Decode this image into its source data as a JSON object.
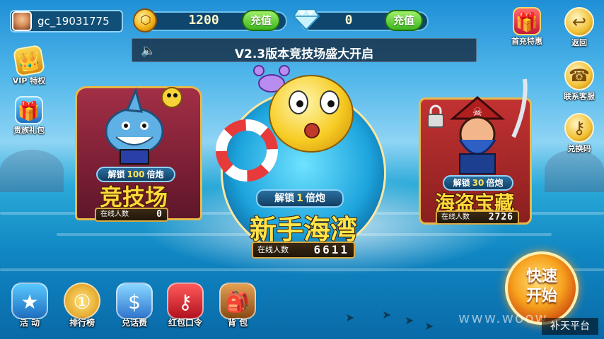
{
  "user": {
    "name": "gc_19031775"
  },
  "resources": {
    "gold": {
      "value": "1200",
      "charge_label": "充值"
    },
    "diamond": {
      "value": "0",
      "charge_label": "充值"
    }
  },
  "notice": {
    "text": "V2.3版本竞技场盛大开启"
  },
  "left_menu": {
    "vip": "VIP 特权",
    "noble_gift": "贵族礼包"
  },
  "right_menu": {
    "first_charge": "首充特惠",
    "back": "返回",
    "contact": "联系客服",
    "redeem": "兑换码"
  },
  "rooms": {
    "arena": {
      "unlock_prefix": "解锁",
      "unlock_value": "100",
      "unlock_suffix": "倍炮",
      "title": "竞技场",
      "online_label": "在线人数",
      "online_count": "0"
    },
    "newbie": {
      "unlock_prefix": "解锁",
      "unlock_value": "1",
      "unlock_suffix": "倍炮",
      "title": "新手海湾",
      "online_label": "在线人数",
      "online_count": "6611"
    },
    "pirate": {
      "unlock_prefix": "解锁",
      "unlock_value": "30",
      "unlock_suffix": "倍炮",
      "title": "海盗宝藏",
      "online_label": "在线人数",
      "online_count": "2726"
    }
  },
  "bottom_menu": {
    "activity": "活 动",
    "ranking": "排行榜",
    "phone_credit": "兑话费",
    "red_packet": "红包口令",
    "backpack": "背 包"
  },
  "quick_start": {
    "line1": "快速",
    "line2": "开始"
  },
  "watermark": "www.woow",
  "corner_tag": "补天平台",
  "colors": {
    "accent_gold": "#f3b51b",
    "button_green": "#3cb51d",
    "title_gold": "#ffd83a"
  }
}
